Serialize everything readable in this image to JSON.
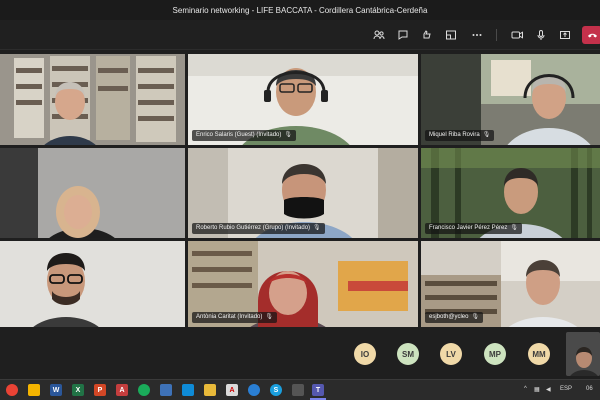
{
  "window": {
    "title": "Seminario networking - LIFE BACCATA - Cordillera Cantábrica-Cerdeña"
  },
  "toolbar": {
    "icons": [
      "people-icon",
      "chat-icon",
      "react-icon",
      "rooms-icon",
      "more-icon",
      "camera-icon",
      "mic-icon",
      "share-icon",
      "leave-icon"
    ]
  },
  "participants": [
    {
      "name": ""
    },
    {
      "name": "Enrico Salaris (Guest) (Invitado)"
    },
    {
      "name": "Miquel Riba Rovira"
    },
    {
      "name": ""
    },
    {
      "name": "Roberto Rubio Gutiérrez (Grupo) (Invitado)"
    },
    {
      "name": "Francisco Javier Pérez Pérez"
    },
    {
      "name": ""
    },
    {
      "name": "Antònia Caritat (Invitado)"
    },
    {
      "name": "esjboth@ycleo"
    }
  ],
  "avatars": [
    {
      "initials": "IO"
    },
    {
      "initials": "SM"
    },
    {
      "initials": "LV"
    },
    {
      "initials": "MP"
    },
    {
      "initials": "MM"
    }
  ],
  "taskbar": {
    "language": "ESP",
    "time": "06"
  },
  "colors": {
    "accent": "#6264a7",
    "leave": "#c4314b",
    "bg": "#1f1f1f"
  }
}
